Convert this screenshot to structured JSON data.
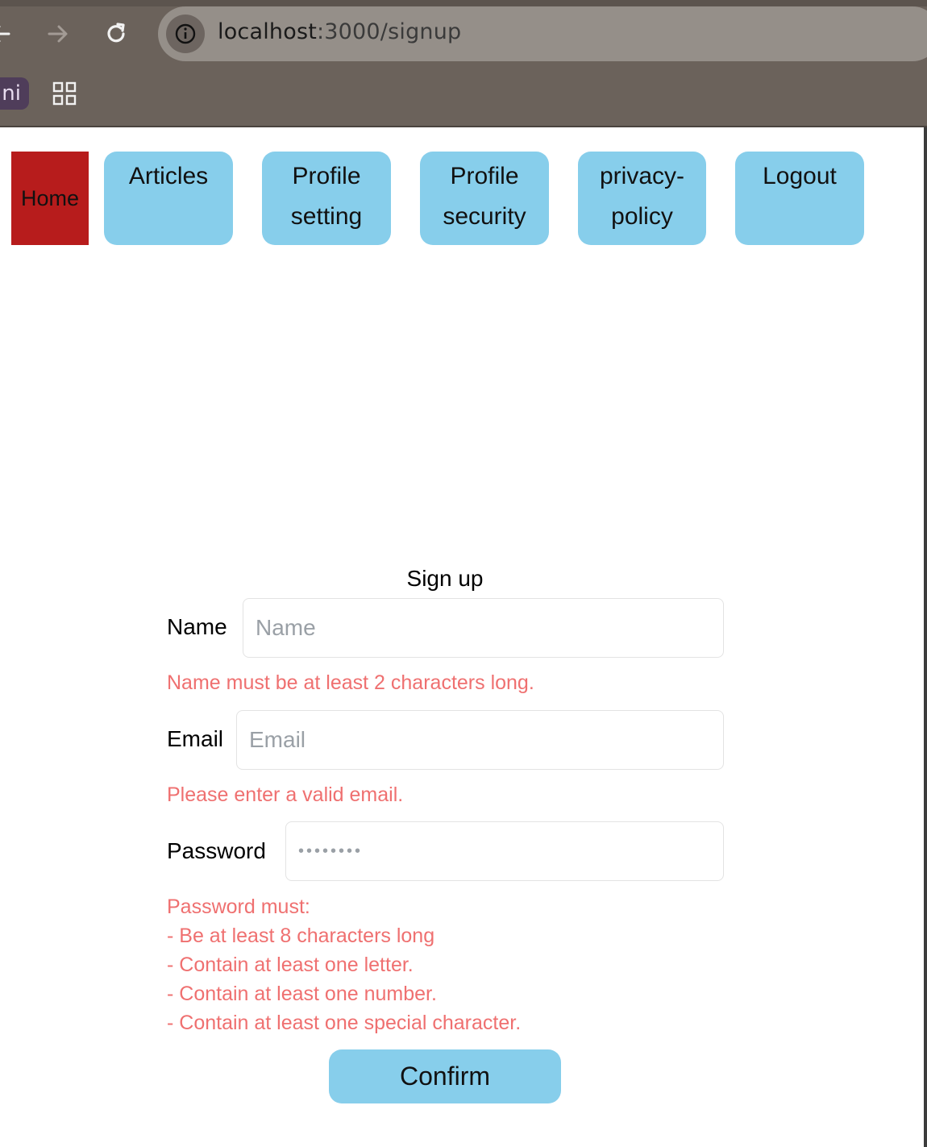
{
  "browser": {
    "url_host": "localhost",
    "url_path": ":3000/signup",
    "bookmark_label": "ni",
    "icons": [
      "back-icon",
      "forward-icon",
      "reload-icon",
      "info-icon",
      "apps-icon"
    ]
  },
  "nav": {
    "home": "Home",
    "articles": "Articles",
    "profile_setting_1": "Profile",
    "profile_setting_2": "setting",
    "profile_security_1": "Profile",
    "profile_security_2": "security",
    "privacy_1": "privacy-",
    "privacy_2": "policy",
    "logout": "Logout"
  },
  "form": {
    "title": "Sign up",
    "name_label": "Name",
    "name_placeholder": "Name",
    "name_error": "Name must be at least 2 characters long.",
    "email_label": "Email",
    "email_placeholder": "Email",
    "email_error": "Please enter a valid email.",
    "password_label": "Password",
    "password_placeholder": "••••••••",
    "password_error": [
      "Password must:",
      "- Be at least 8 characters long",
      "- Contain at least one letter.",
      "- Contain at least one number.",
      "- Contain at least one special character."
    ],
    "confirm": "Confirm"
  },
  "colors": {
    "nav_button": "#87ceeb",
    "home_active": "#b71c1c",
    "error_text": "#ef7070",
    "chrome": "#6b625b"
  }
}
